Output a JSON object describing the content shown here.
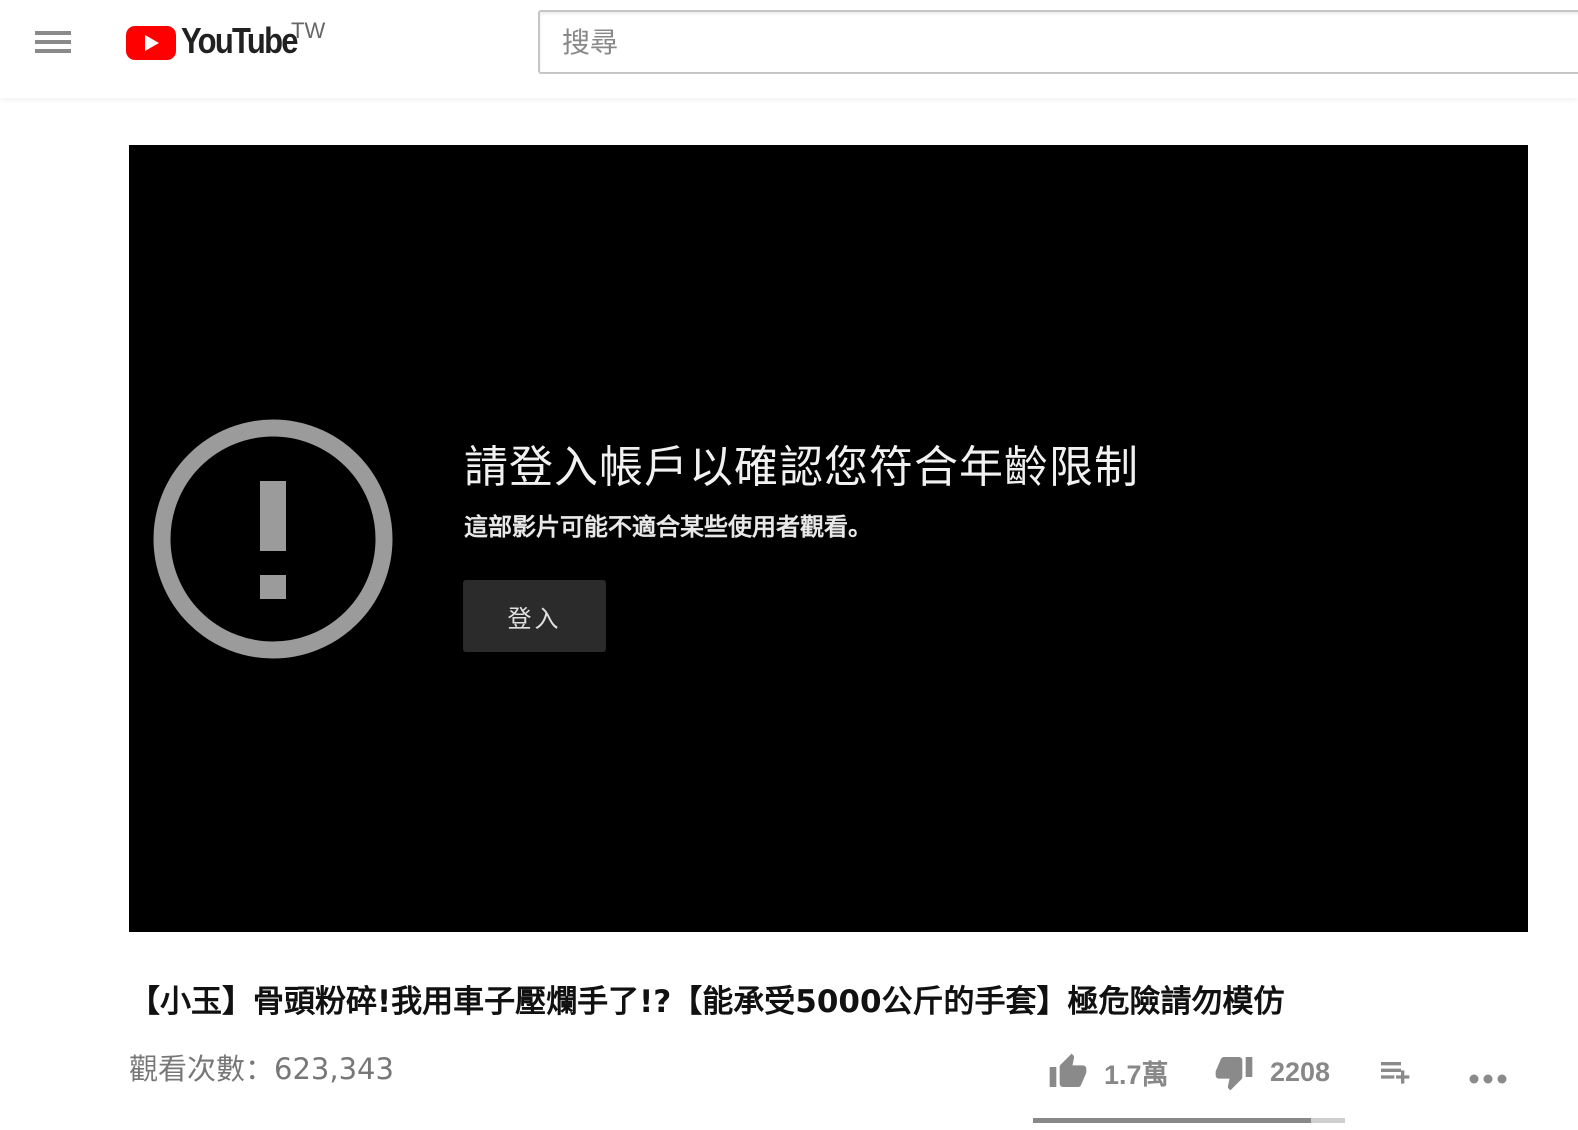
{
  "header": {
    "logo_text": "YouTube",
    "country_code": "TW",
    "search_placeholder": "搜尋",
    "brand_color": "#ff0000"
  },
  "player": {
    "message_title": "請登入帳戶以確認您符合年齡限制",
    "message_subtitle": "這部影片可能不適合某些使用者觀看。",
    "signin_label": "登入",
    "icon": "alert-circle-icon"
  },
  "video": {
    "title": "【小玉】骨頭粉碎!我用車子壓爛手了!?【能承受5000公斤的手套】極危險請勿模仿",
    "views": "觀看次數：623,343",
    "likes": "1.7萬",
    "dislikes": "2208",
    "like_ratio": 0.89,
    "icons": [
      "thumb-up-icon",
      "thumb-down-icon",
      "add-to-playlist-icon",
      "more-icon"
    ]
  }
}
